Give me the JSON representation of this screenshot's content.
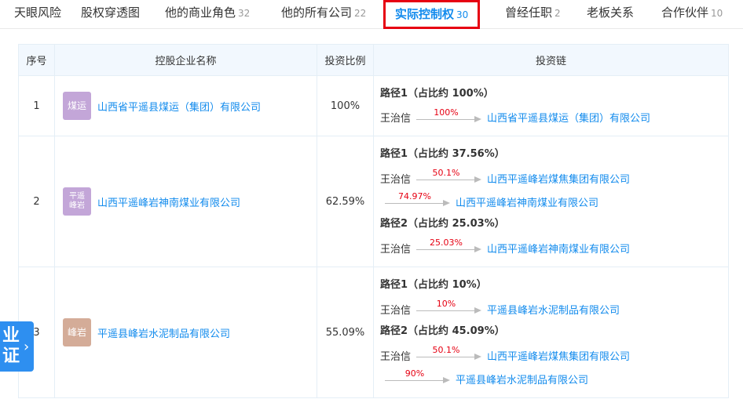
{
  "tabs": [
    {
      "label": "天眼风险",
      "count": ""
    },
    {
      "label": "股权穿透图",
      "count": ""
    },
    {
      "label": "他的商业角色",
      "count": "32"
    },
    {
      "label": "他的所有公司",
      "count": "22"
    },
    {
      "label": "实际控制权",
      "count": "30"
    },
    {
      "label": "曾经任职",
      "count": "2"
    },
    {
      "label": "老板关系",
      "count": ""
    },
    {
      "label": "合作伙伴",
      "count": "10"
    }
  ],
  "table": {
    "headers": [
      "序号",
      "控股企业名称",
      "投资比例",
      "投资链"
    ],
    "rows": [
      {
        "index": "1",
        "logo": "煤运",
        "logo_color": "#c3a6d8",
        "company": "山西省平遥县煤运（集团）有限公司",
        "ratio": "100%",
        "paths": [
          {
            "title": "路径1（占比约 100%）",
            "links": [
              {
                "from": "王治信",
                "pct": "100%",
                "to": "山西省平遥县煤运（集团）有限公司"
              }
            ]
          }
        ]
      },
      {
        "index": "2",
        "logo": "平遥峰岩",
        "logo_color": "#c3a6d8",
        "company": "山西平遥峰岩神南煤业有限公司",
        "ratio": "62.59%",
        "paths": [
          {
            "title": "路径1（占比约 37.56%）",
            "links": [
              {
                "from": "王治信",
                "pct": "50.1%",
                "to": "山西平遥峰岩煤焦集团有限公司"
              },
              {
                "from": "",
                "pct": "74.97%",
                "to": "山西平遥峰岩神南煤业有限公司"
              }
            ]
          },
          {
            "title": "路径2（占比约 25.03%）",
            "links": [
              {
                "from": "王治信",
                "pct": "25.03%",
                "to": "山西平遥峰岩神南煤业有限公司"
              }
            ]
          }
        ]
      },
      {
        "index": "3",
        "logo": "峰岩",
        "logo_color": "#d4ac98",
        "company": "平遥县峰岩水泥制品有限公司",
        "ratio": "55.09%",
        "paths": [
          {
            "title": "路径1（占比约 10%）",
            "links": [
              {
                "from": "王治信",
                "pct": "10%",
                "to": "平遥县峰岩水泥制品有限公司"
              }
            ]
          },
          {
            "title": "路径2（占比约 45.09%）",
            "links": [
              {
                "from": "王治信",
                "pct": "50.1%",
                "to": "山西平遥峰岩煤焦集团有限公司"
              },
              {
                "from": "",
                "pct": "90%",
                "to": "平遥县峰岩水泥制品有限公司"
              }
            ]
          }
        ]
      }
    ]
  },
  "float_badge": {
    "text": "业证",
    "icon": "chevron-right-icon"
  }
}
